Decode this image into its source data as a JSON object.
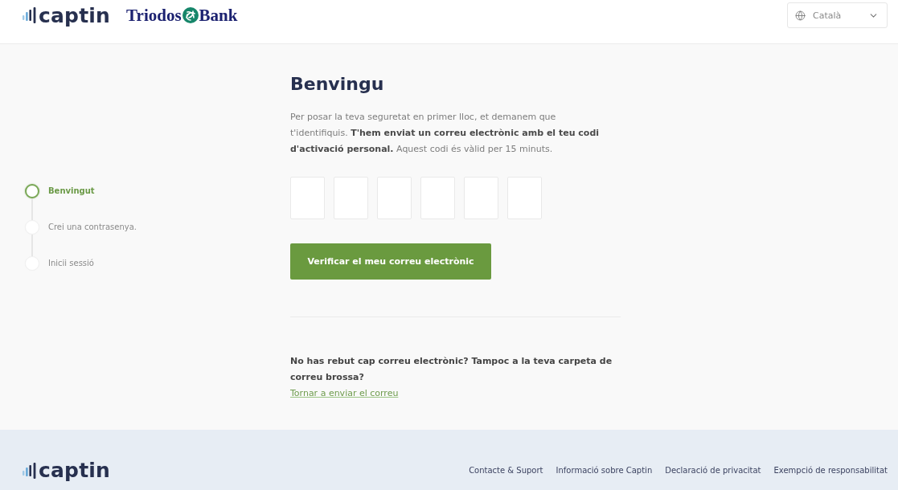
{
  "header": {
    "brand": "captin",
    "partner": {
      "word_1": "Triodos",
      "word_2": "Bank"
    },
    "language": {
      "value": "Català"
    }
  },
  "steps": [
    {
      "label": "Benvingut",
      "selected": true
    },
    {
      "label": "Crei una contrasenya.",
      "selected": false
    },
    {
      "label": "Inicii sessió",
      "selected": false
    }
  ],
  "verification": {
    "title": "Benvingu",
    "intro": "Per posar la teva seguretat en primer lloc, et demanem que t'identifiquis. **T'hem enviat un correu electrònic amb el teu codi d'activació personal.** Aquest codi és vàlid per 15 minuts.",
    "code_fields": [
      {
        "kind": "digit"
      },
      {
        "kind": "digit"
      },
      {
        "kind": "digit"
      },
      {
        "kind": "digit"
      },
      {
        "kind": "digit"
      },
      {
        "kind": "digit"
      }
    ],
    "submit_button": "Verificar el meu correu electrònic",
    "help_text": "No has rebut cap correu electrònic? Tampoc a la teva carpeta de correu brossa?",
    "resend_link": "Tornar a enviar el correu"
  },
  "footer": {
    "brand": "captin",
    "links": [
      "Contacte & Suport",
      "Informació sobre Captin",
      "Declaració de privacitat",
      "Exempció de responsabilitat"
    ]
  }
}
